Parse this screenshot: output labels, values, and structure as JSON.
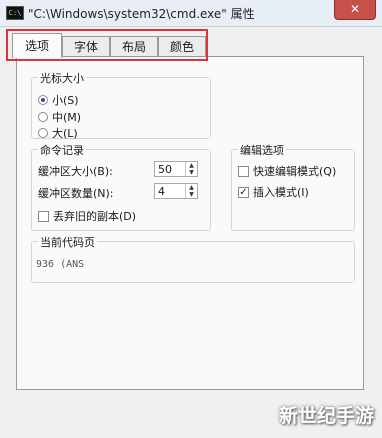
{
  "window": {
    "title": "\"C:\\Windows\\system32\\cmd.exe\" 属性",
    "icon_name": "cmd-icon",
    "icon_text": "C:\\",
    "close_label": "✕"
  },
  "tabs": [
    {
      "label": "选项",
      "active": true
    },
    {
      "label": "字体",
      "active": false
    },
    {
      "label": "布局",
      "active": false
    },
    {
      "label": "颜色",
      "active": false
    }
  ],
  "cursor_size": {
    "title": "光标大小",
    "options": [
      {
        "label": "小(S)",
        "checked": true
      },
      {
        "label": "中(M)",
        "checked": false
      },
      {
        "label": "大(L)",
        "checked": false
      }
    ]
  },
  "command_history": {
    "title": "命令记录",
    "buffer_size_label": "缓冲区大小(B):",
    "buffer_size_value": "50",
    "buffer_count_label": "缓冲区数量(N):",
    "buffer_count_value": "4",
    "discard_label": "丢弃旧的副本(D)",
    "discard_checked": false
  },
  "edit_options": {
    "title": "编辑选项",
    "quick_edit_label": "快速编辑模式(Q)",
    "quick_edit_checked": false,
    "insert_mode_label": "插入模式(I)",
    "insert_mode_checked": true
  },
  "codepage": {
    "title": "当前代码页",
    "value": "936   (ANS"
  },
  "watermark": "新世纪手游",
  "colors": {
    "highlight": "#e03434",
    "close_button": "#c8504a"
  }
}
